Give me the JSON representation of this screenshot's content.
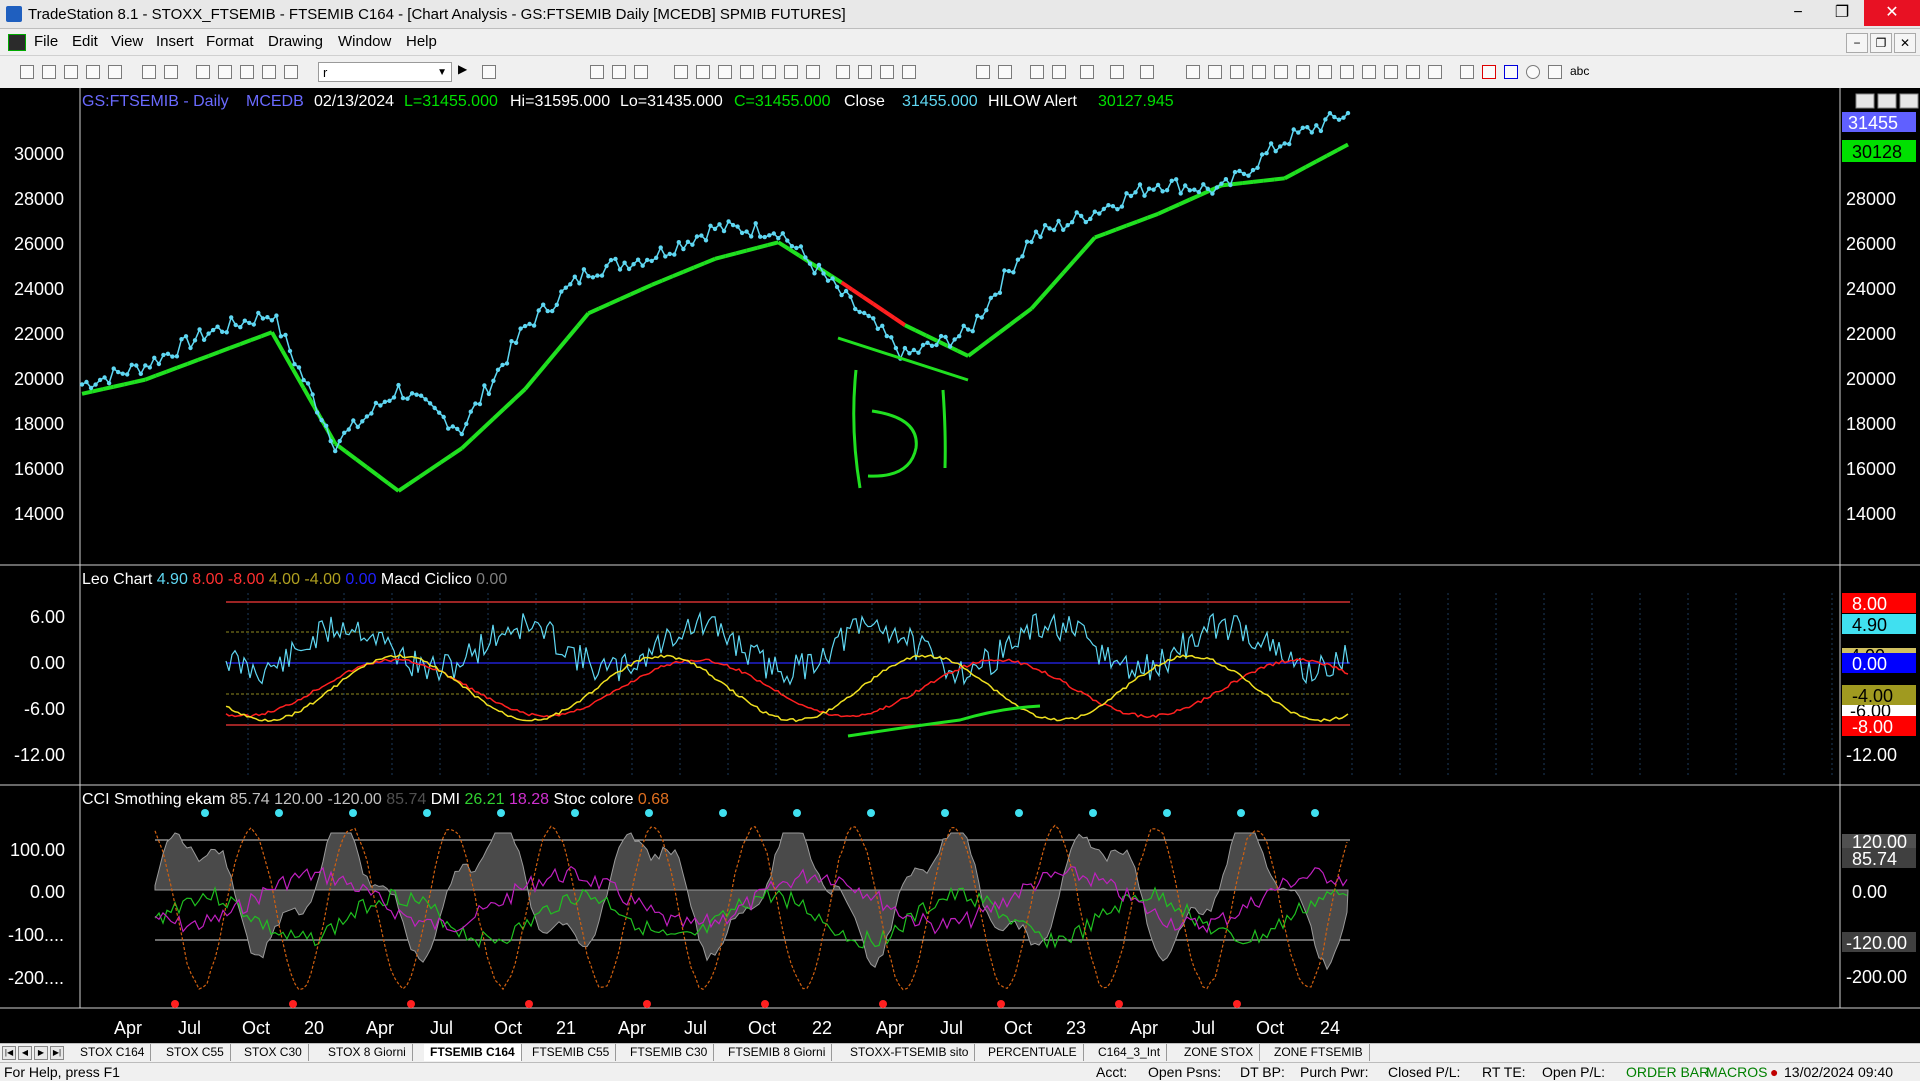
{
  "window": {
    "title": "TradeStation 8.1 - STOXX_FTSEMIB - FTSEMIB C164 - [Chart Analysis - GS:FTSEMIB  Daily  [MCEDB] SPMIB FUTURES]",
    "minimize": "−",
    "maximize": "❐",
    "close": "✕"
  },
  "menu": {
    "items": [
      "File",
      "Edit",
      "View",
      "Insert",
      "Format",
      "Drawing",
      "Window",
      "Help"
    ],
    "mdi_minimize": "−",
    "mdi_restore": "❐",
    "mdi_close": "✕"
  },
  "toolbar": {
    "combo_value": "r",
    "text_tool_label": "abc"
  },
  "chart_header": {
    "symbol": "GS:FTSEMIB - Daily",
    "study": "MCEDB",
    "date": "02/13/2024",
    "last": "L=31455.000",
    "high": "Hi=31595.000",
    "low": "Lo=31435.000",
    "close_eq": "C=31455.000",
    "close_label": "Close",
    "close_value": "31455.000",
    "alert_label": "HILOW Alert",
    "alert_value": "30127.945"
  },
  "price_panel": {
    "yticks": [
      "30000",
      "28000",
      "26000",
      "24000",
      "22000",
      "20000",
      "18000",
      "16000",
      "14000"
    ],
    "last_tag": "31455",
    "alert_tag": "30128",
    "annotation": "Handwritten 'D' drawing with trendlines"
  },
  "osc_panel": {
    "legend": [
      {
        "text": "Leo Chart",
        "color": "#ffffff"
      },
      {
        "text": "4.90",
        "color": "#5fd7f2"
      },
      {
        "text": "8.00",
        "color": "#ff3030"
      },
      {
        "text": "-8.00",
        "color": "#ff3030"
      },
      {
        "text": "4.00",
        "color": "#b0a020"
      },
      {
        "text": "-4.00",
        "color": "#b0a020"
      },
      {
        "text": "0.00",
        "color": "#2020ff"
      },
      {
        "text": "Macd Ciclico",
        "color": "#ffffff"
      },
      {
        "text": "0.00",
        "color": "#808080"
      }
    ],
    "yticks": [
      "6.00",
      "0.00",
      "-6.00",
      "-12.00"
    ],
    "right_yticks": [
      "-12.00"
    ],
    "tags": [
      {
        "text": "8.00",
        "bg": "#ff0000",
        "fg": "#ffffff"
      },
      {
        "text": "4.90",
        "bg": "#40e0f0",
        "fg": "#000000"
      },
      {
        "text": "0.00",
        "bg": "#0000ff",
        "fg": "#ffffff"
      },
      {
        "text": "-4.00",
        "bg": "#a09a20",
        "fg": "#000000"
      },
      {
        "text": "-8.00",
        "bg": "#ff0000",
        "fg": "#ffffff"
      }
    ],
    "hidden_tag_a": "4.00",
    "hidden_tag_b": "-6.00"
  },
  "cci_panel": {
    "legend": [
      {
        "text": "CCI Smothing ekam",
        "color": "#ffffff"
      },
      {
        "text": "85.74",
        "color": "#c0c0c0"
      },
      {
        "text": "120.00",
        "color": "#c0c0c0"
      },
      {
        "text": "-120.00",
        "color": "#c0c0c0"
      },
      {
        "text": "85.74",
        "color": "#505050"
      },
      {
        "text": "DMI",
        "color": "#ffffff"
      },
      {
        "text": "26.21",
        "color": "#30d030"
      },
      {
        "text": "18.28",
        "color": "#d030d0"
      },
      {
        "text": "Stoc colore",
        "color": "#ffffff"
      },
      {
        "text": "0.68",
        "color": "#e07020"
      }
    ],
    "yticks": [
      "100.00",
      "0.00",
      "-100....",
      "-200...."
    ],
    "tag_120": "120.00",
    "tag_85": "85.74",
    "tag_0": "0.00",
    "tag_m120": "-120.00",
    "tag_m200": "-200.00"
  },
  "xaxis": {
    "labels": [
      "Apr",
      "Jul",
      "Oct",
      "20",
      "Apr",
      "Jul",
      "Oct",
      "21",
      "Apr",
      "Jul",
      "Oct",
      "22",
      "Apr",
      "Jul",
      "Oct",
      "23",
      "Apr",
      "Jul",
      "Oct",
      "24"
    ]
  },
  "tabs": {
    "items": [
      "STOX C164",
      "STOX C55",
      "STOX  C30",
      "STOX  8 Giorni",
      "FTSEMIB C164",
      "FTSEMIB C55",
      "FTSEMIB C30",
      "FTSEMIB  8 Giorni",
      "STOXX-FTSEMIB sito",
      "PERCENTUALE",
      "C164_3_Int",
      "ZONE STOX",
      "ZONE FTSEMIB"
    ],
    "active_index": 4
  },
  "status": {
    "help": "For Help, press F1",
    "acct": "Acct:",
    "open_psns": "Open Psns:",
    "dt_bp": "DT BP:",
    "purch_pwr": "Purch Pwr:",
    "closed_pl": "Closed P/L:",
    "rt_te": "RT TE:",
    "open_pl": "Open P/L:",
    "order_bar": "ORDER BAR",
    "macros": "MACROS",
    "datetime": "13/02/2024 09:40"
  },
  "chart_data": {
    "type": "line",
    "title": "GS:FTSEMIB - Daily",
    "x": [
      "2019-04",
      "2019-07",
      "2019-10",
      "2020-01",
      "2020-04",
      "2020-07",
      "2020-10",
      "2021-01",
      "2021-04",
      "2021-07",
      "2021-10",
      "2022-01",
      "2022-04",
      "2022-07",
      "2022-10",
      "2023-01",
      "2023-04",
      "2023-07",
      "2023-10",
      "2024-01",
      "2024-02"
    ],
    "series": [
      {
        "name": "Close",
        "color": "#5fd7f2",
        "values": [
          20000,
          20800,
          22200,
          23000,
          17500,
          19800,
          18100,
          22400,
          24800,
          25400,
          26600,
          26500,
          23800,
          21200,
          22200,
          26200,
          27300,
          28500,
          28200,
          30300,
          31455
        ]
      },
      {
        "name": "HILOW Alert",
        "color": "#00e000",
        "values": [
          19600,
          20200,
          21200,
          22200,
          17500,
          15500,
          17300,
          19800,
          23000,
          24200,
          25300,
          26000,
          24300,
          22500,
          21200,
          23200,
          26200,
          27200,
          28400,
          28700,
          30128
        ]
      }
    ],
    "ylim": [
      12500,
      31500
    ],
    "ylabel": "",
    "xlabel": ""
  }
}
